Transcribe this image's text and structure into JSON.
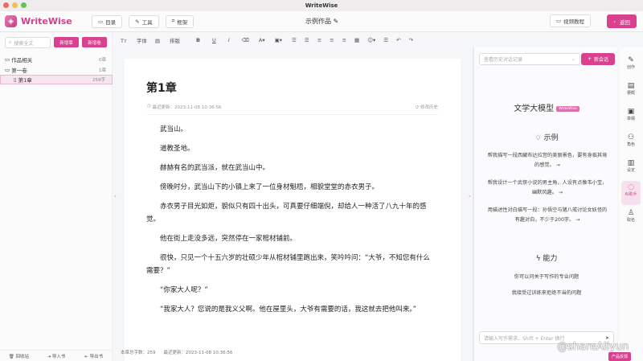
{
  "window": {
    "title": "WriteWise"
  },
  "header": {
    "logo": "WriteWise",
    "nav": [
      {
        "label": "目录",
        "icon": "folder-icon"
      },
      {
        "label": "工具",
        "icon": "wrench-icon"
      },
      {
        "label": "框架",
        "icon": "frame-icon"
      }
    ],
    "doc_title": "示例作品",
    "video": "视频教程",
    "back": "返回"
  },
  "left": {
    "search_placeholder": "搜索全文",
    "new_chapter": "新增章",
    "new_volume": "新增卷",
    "tree": [
      {
        "label": "作品相关",
        "count": "0章"
      },
      {
        "label": "第一卷",
        "count": "1章"
      },
      {
        "label": "第1章",
        "count": "259字"
      }
    ],
    "footer": [
      "回收站",
      "导入书",
      "导出书"
    ]
  },
  "toolbar": {
    "font": "字体",
    "layout": "排版",
    "bold": "B",
    "underline": "U",
    "italic": "I"
  },
  "editor": {
    "chapter_title": "第1章",
    "updated": "最近更新：2023-11-08 10:36:56",
    "history": "修改历史",
    "paragraphs": [
      "武当山。",
      "道教圣地。",
      "赫赫有名的武当派，就在武当山中。",
      "傍晚时分，武当山下的小镇上来了一位身材魁梧，相貌堂堂的赤衣男子。",
      "赤衣男子目光如炬，貌似只有四十出头，可真要仔细端倪，却给人一种活了八九十年的感觉。",
      "他在街上走没多远，突然停在一家棺材铺前。",
      "很快，只见一个十五六岁的壮硕少年从棺材铺里跑出来，笑吟吟问：“大爷，不知您有什么需要？”",
      "“你家大人呢？”",
      "“我家大人？您说的是我义父啊。他在屋里头，大爷有需要的话，我这就去把他叫来。”"
    ],
    "footer_count": "本章总字数：259",
    "footer_updated": "最近更新：2023-11-08 10:36:56"
  },
  "ai": {
    "history_placeholder": "查看历史对话记录",
    "new_chat": "新会话",
    "model_title": "文学大模型",
    "badge": "WriteWise",
    "examples_title": "示例",
    "examples": [
      "帮我描写一段西藏布达拉宫的美丽景色，要有身临其境的感觉。 →",
      "帮我设计一个武侠小说的男主角，人设有点像韦小宝，幽默风趣。 →",
      "用描述性对白描写一段：孙悟空与猪八戒讨论女妖怪的有趣对白，不少于200字。 →"
    ],
    "ability_title": "能力",
    "abilities": [
      "你可以问关于写作的专业问题",
      "我接受过训练来拒绝不当的问题"
    ],
    "input_placeholder": "请输入写作需求、Shift + Enter 换行"
  },
  "rail": [
    {
      "label": "创作",
      "icon": "pen-icon"
    },
    {
      "label": "梗概",
      "icon": "outline-icon"
    },
    {
      "label": "章纲",
      "icon": "chapter-outline-icon"
    },
    {
      "label": "角色",
      "icon": "people-icon"
    },
    {
      "label": "设定",
      "icon": "book-icon"
    },
    {
      "label": "AI助手",
      "icon": "chat-icon",
      "active": true
    },
    {
      "label": "取名",
      "icon": "person-icon"
    }
  ],
  "feedback": "产品反馈",
  "watermark": "@shareAliyun",
  "colors": {
    "accent": "#d9408f"
  }
}
